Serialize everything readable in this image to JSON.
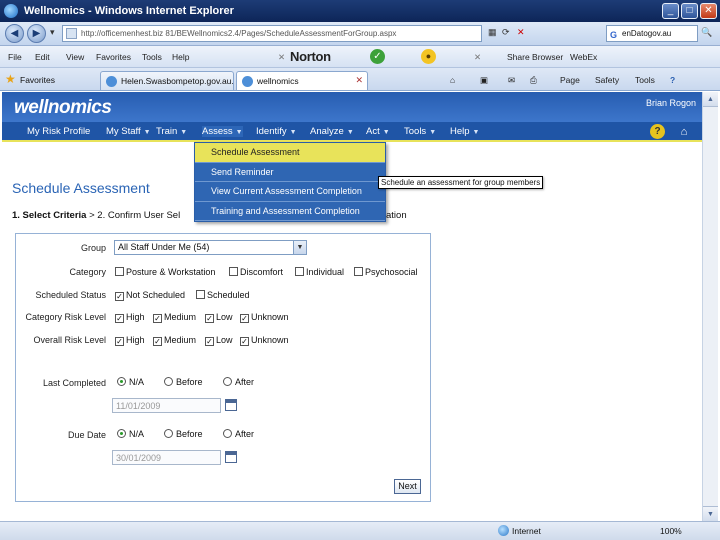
{
  "window": {
    "title": "Wellnomics - Windows Internet Explorer",
    "minimize": "_",
    "maximize": "□",
    "close": "✕"
  },
  "address": {
    "url": "http://officemenhest.biz 81/BEWellnomics2.4/Pages/ScheduleAssessmentForGroup.aspx",
    "search_value": "enDatogov.au",
    "go_glyph": "→"
  },
  "menubar": {
    "items": [
      "File",
      "Edit",
      "View",
      "Favorites",
      "Tools",
      "Help"
    ],
    "norton": "Norton",
    "share": "Share Browser",
    "webex": "WebEx"
  },
  "tabs": {
    "favorites": "Favorites",
    "items": [
      "Helen.Swasbompetop.gov.au...",
      "wellnomics"
    ],
    "commands": [
      "Page",
      "Safety",
      "Tools"
    ]
  },
  "app": {
    "logo": "wellnomics",
    "user": "Brian Rogon",
    "nav": [
      "My Risk Profile",
      "My Staff",
      "Train",
      "Assess",
      "Identify",
      "Analyze",
      "Act",
      "Tools",
      "Help"
    ]
  },
  "dropdown": {
    "items": [
      "Schedule Assessment",
      "Send Reminder",
      "View Current Assessment Completion",
      "Training and Assessment Completion"
    ],
    "tooltip": "Schedule an assessment for group members"
  },
  "page": {
    "title": "Schedule Assessment",
    "breadcrumb_step1": "1. Select Criteria",
    "breadcrumb_sep": " > 2. Confirm User Sel",
    "breadcrumb_tail": "ation"
  },
  "form": {
    "labels": {
      "group": "Group",
      "category": "Category",
      "scheduled_status": "Scheduled Status",
      "category_risk": "Category Risk Level",
      "overall_risk": "Overall Risk Level",
      "last_completed": "Last Completed",
      "due_date": "Due Date"
    },
    "group_value": "All Staff Under Me (54)",
    "category_options": [
      "Posture & Workstation",
      "Discomfort",
      "Individual",
      "Psychosocial"
    ],
    "status_options": [
      "Not Scheduled",
      "Scheduled"
    ],
    "risk_options": [
      "High",
      "Medium",
      "Low",
      "Unknown"
    ],
    "radio_options": [
      "N/A",
      "Before",
      "After"
    ],
    "last_completed_date": "11/01/2009",
    "due_date_value": "30/01/2009",
    "next_label": "Next"
  },
  "status": {
    "zone": "Internet",
    "zoom": "100%"
  }
}
